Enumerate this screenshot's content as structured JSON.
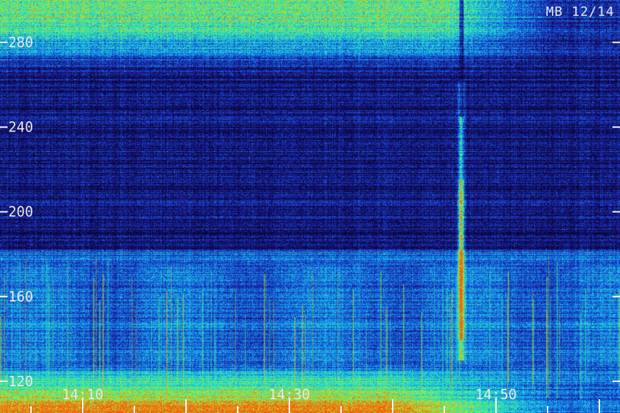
{
  "station_label": "MB 12/14",
  "chart_data": {
    "type": "heatmap",
    "title": "",
    "xlabel": "",
    "ylabel": "",
    "x_ticks": [
      {
        "label": "14:10",
        "minutes": 10
      },
      {
        "label": "14:30",
        "minutes": 30
      },
      {
        "label": "14:50",
        "minutes": 50
      }
    ],
    "x_range_minutes": [
      2,
      62
    ],
    "x_minor_step_minutes": 5,
    "y_ticks": [
      {
        "label": "120",
        "value": 120
      },
      {
        "label": "160",
        "value": 160
      },
      {
        "label": "200",
        "value": 200
      },
      {
        "label": "240",
        "value": 240
      },
      {
        "label": "280",
        "value": 280
      }
    ],
    "y_range": [
      105,
      300
    ],
    "colormap": [
      "#0a0530",
      "#1a1a9a",
      "#1560e0",
      "#18c8e8",
      "#40f090",
      "#c8e020",
      "#f06010"
    ],
    "features": [
      {
        "kind": "vertical_burst",
        "time_minutes": 46.6,
        "intensity": 1.0,
        "y_from": 130,
        "y_to": 262
      },
      {
        "kind": "horizontal_band",
        "y_value": 183,
        "intensity": 0.9
      },
      {
        "kind": "horizontal_band",
        "y_value": 190,
        "intensity": 0.35
      },
      {
        "kind": "low_band_emission",
        "y_from": 105,
        "y_to": 128,
        "intensity": 0.7
      },
      {
        "kind": "high_band_emission",
        "y_from": 265,
        "y_to": 300,
        "intensity": 0.6
      }
    ],
    "grid": false,
    "legend": "none"
  }
}
